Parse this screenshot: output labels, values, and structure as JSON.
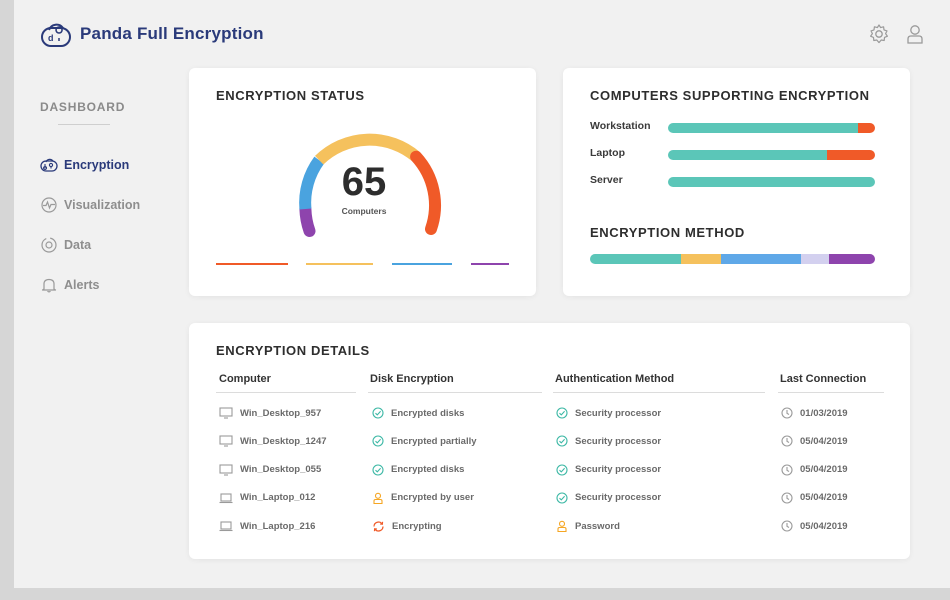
{
  "app": {
    "title": "Panda Full Encryption"
  },
  "sidebar": {
    "heading": "DASHBOARD",
    "items": [
      {
        "label": "Encryption",
        "icon": "encryption-icon",
        "active": true
      },
      {
        "label": "Visualization",
        "icon": "visualization-icon",
        "active": false
      },
      {
        "label": "Data",
        "icon": "data-icon",
        "active": false
      },
      {
        "label": "Alerts",
        "icon": "bell-icon",
        "active": false
      }
    ]
  },
  "status_card": {
    "title": "ENCRYPTION STATUS",
    "count": "65",
    "count_label": "Computers",
    "segments": [
      {
        "color": "#8e44ad"
      },
      {
        "color": "#4aa3df"
      },
      {
        "color": "#f5c15d"
      },
      {
        "color": "#f05a28"
      }
    ]
  },
  "support_card": {
    "title": "COMPUTERS SUPPORTING ENCRYPTION",
    "rows": [
      {
        "label": "Workstation",
        "supported": 0.92
      },
      {
        "label": "Laptop",
        "supported": 0.77
      },
      {
        "label": "Server",
        "supported": 1.0
      }
    ],
    "method_title": "ENCRYPTION METHOD",
    "method_segments": [
      {
        "color": "#5bc6b8",
        "fraction": 0.32
      },
      {
        "color": "#f5c15d",
        "fraction": 0.14
      },
      {
        "color": "#5fa8e8",
        "fraction": 0.28
      },
      {
        "color": "#d3d0ef",
        "fraction": 0.1
      },
      {
        "color": "#8e44ad",
        "fraction": 0.16
      }
    ],
    "colors": {
      "supported": "#5bc6b8",
      "unsupported": "#f05a28"
    }
  },
  "details_card": {
    "title": "ENCRYPTION DETAILS",
    "columns": [
      "Computer",
      "Disk Encryption",
      "Authentication Method",
      "Last Connection"
    ],
    "rows": [
      {
        "computer": "Win_Desktop_957",
        "device_icon": "desktop-icon",
        "disk": "Encrypted disks",
        "disk_icon": "check-circle-icon",
        "auth": "Security processor",
        "auth_icon": "check-circle-icon",
        "last": "01/03/2019"
      },
      {
        "computer": "Win_Desktop_1247",
        "device_icon": "desktop-icon",
        "disk": "Encrypted partially",
        "disk_icon": "check-circle-icon",
        "auth": "Security processor",
        "auth_icon": "check-circle-icon",
        "last": "05/04/2019"
      },
      {
        "computer": "Win_Desktop_055",
        "device_icon": "desktop-icon",
        "disk": "Encrypted disks",
        "disk_icon": "check-circle-icon",
        "auth": "Security processor",
        "auth_icon": "check-circle-icon",
        "last": "05/04/2019"
      },
      {
        "computer": "Win_Laptop_012",
        "device_icon": "laptop-icon",
        "disk": "Encrypted by user",
        "disk_icon": "user-icon",
        "auth": "Security processor",
        "auth_icon": "check-circle-icon",
        "last": "05/04/2019"
      },
      {
        "computer": "Win_Laptop_216",
        "device_icon": "laptop-icon",
        "disk": "Encrypting",
        "disk_icon": "sync-icon",
        "auth": "Password",
        "auth_icon": "lock-icon",
        "last": "05/04/2019"
      }
    ]
  }
}
